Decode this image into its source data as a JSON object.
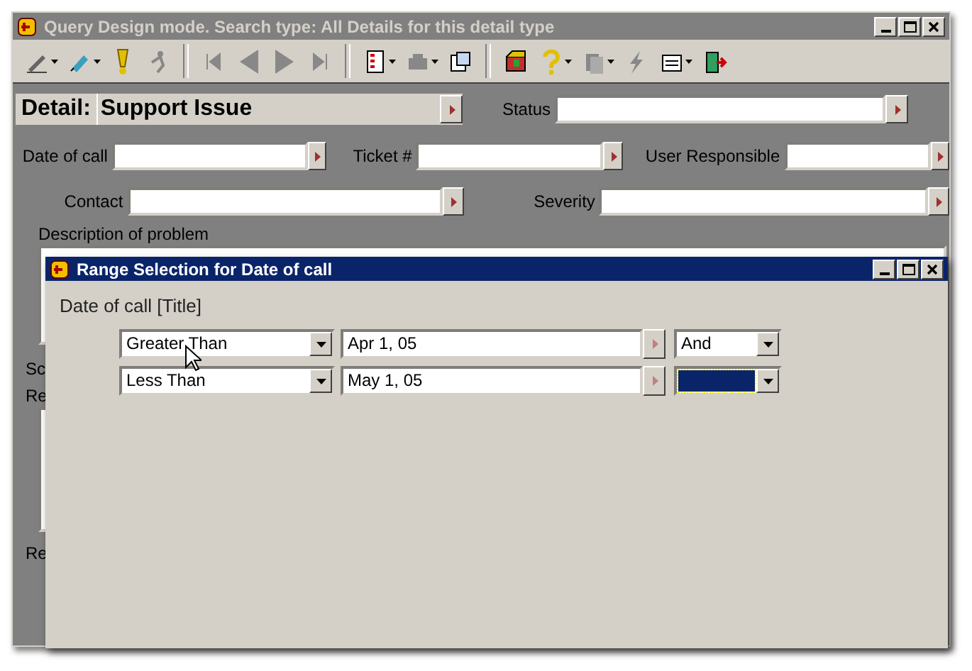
{
  "window": {
    "title": "Query Design mode. Search type: All Details for this detail type"
  },
  "detail": {
    "label": "Detail:",
    "value": "Support Issue"
  },
  "form": {
    "rows": [
      {
        "fields": [
          {
            "label": "Status",
            "kind": "arrow-right"
          }
        ]
      },
      {
        "fields": [
          {
            "label": "Date of call",
            "kind": "arrow"
          },
          {
            "label": "Ticket #",
            "kind": "arrow"
          },
          {
            "label": "User Responsible",
            "kind": "arrow-right"
          }
        ]
      },
      {
        "fields": [
          {
            "label": "Contact",
            "kind": "arrow"
          },
          {
            "label": "Severity",
            "kind": "arrow-right"
          }
        ]
      }
    ],
    "description_label": "Description of problem",
    "covered_labels": [
      "Sc",
      "Re",
      "Re"
    ]
  },
  "dialog": {
    "title": "Range Selection for Date of call",
    "heading": "Date of call [Title]",
    "conditions": [
      {
        "operator": "Greater Than",
        "value": "Apr 1, 05",
        "conjunction": "And"
      },
      {
        "operator": "Less Than",
        "value": "May 1, 05",
        "focused": true
      }
    ]
  }
}
